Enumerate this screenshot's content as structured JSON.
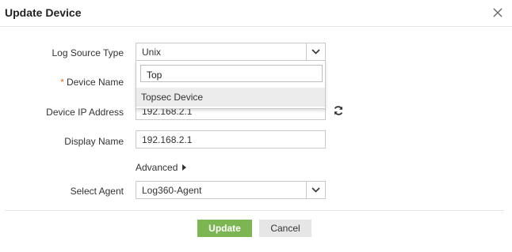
{
  "dialog": {
    "title": "Update Device"
  },
  "form": {
    "log_source_type": {
      "label": "Log Source Type",
      "value": "Unix"
    },
    "device_name": {
      "required_marker": "*",
      "label": "Device Name"
    },
    "device_ip": {
      "label": "Device IP Address",
      "value": "192.168.2.1"
    },
    "display_name": {
      "label": "Display Name",
      "value": "192.168.2.1"
    },
    "advanced": {
      "label": "Advanced"
    },
    "select_agent": {
      "label": "Select Agent",
      "value": "Log360-Agent"
    }
  },
  "dropdown": {
    "search_value": "Top",
    "options": [
      "Topsec Device"
    ]
  },
  "footer": {
    "update_label": "Update",
    "cancel_label": "Cancel"
  },
  "colors": {
    "primary_button": "#7cb652",
    "required_marker": "#e06a1b"
  },
  "icons": [
    "close-icon",
    "chevron-down-icon",
    "refresh-icon",
    "caret-right-icon"
  ]
}
